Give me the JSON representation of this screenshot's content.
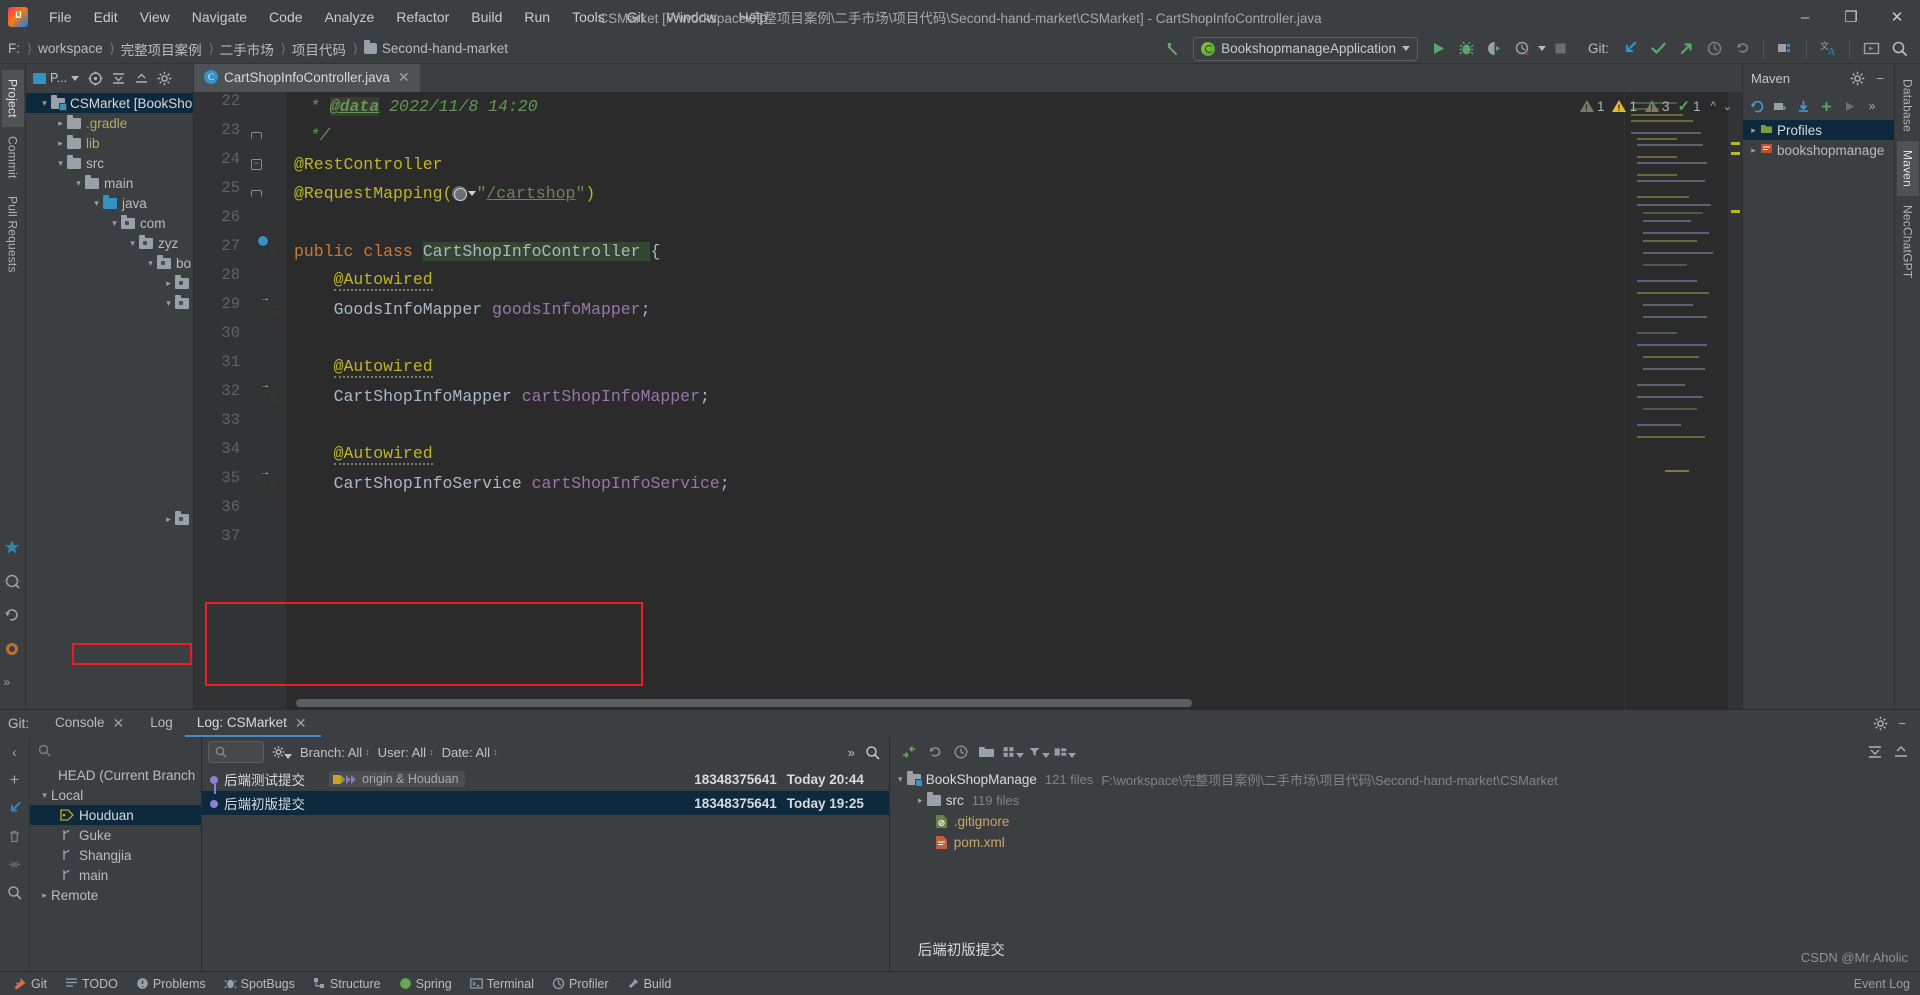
{
  "window": {
    "title": "CSMarket [F:\\workspace\\完整项目案例\\二手市场\\项目代码\\Second-hand-market\\CSMarket] - CartShopInfoController.java",
    "minimize": "–",
    "maximize": "❐",
    "close": "✕"
  },
  "menu": [
    "File",
    "Edit",
    "View",
    "Navigate",
    "Code",
    "Analyze",
    "Refactor",
    "Build",
    "Run",
    "Tools",
    "Git",
    "Window",
    "Help"
  ],
  "breadcrumbs": [
    {
      "label": "F:",
      "folder": false
    },
    {
      "label": "workspace",
      "folder": false
    },
    {
      "label": "完整项目案例",
      "folder": false
    },
    {
      "label": "二手市场",
      "folder": false
    },
    {
      "label": "项目代码",
      "folder": false
    },
    {
      "label": "Second-hand-market",
      "folder": true
    }
  ],
  "toolbar": {
    "run_config": "BookshopmanageApplication",
    "git_label": "Git:",
    "run_title": "Run",
    "debug_title": "Debug",
    "coverage_title": "Run with Coverage",
    "profile_title": "Profile",
    "stop_title": "Stop",
    "update_title": "Update Project",
    "commit_title": "Commit",
    "push_title": "Push",
    "history_title": "History",
    "rollback_title": "Rollback",
    "search_title": "Search Everywhere"
  },
  "left_rail": {
    "tabs": [
      "Project",
      "Commit",
      "Pull Requests"
    ],
    "active": "Project",
    "bottom": [
      "Favorites",
      "Structure",
      "Find",
      "Web"
    ]
  },
  "right_rail": {
    "tabs": [
      "Database",
      "Maven",
      "NecChatGPT"
    ]
  },
  "project_tool": {
    "title": "P...",
    "tree": [
      {
        "label": "CSMarket [BookShop",
        "depth": 0,
        "arrow": "v",
        "icon": "module",
        "selected": true,
        "style": "white"
      },
      {
        "label": ".gradle",
        "depth": 1,
        "arrow": ">",
        "icon": "folder",
        "style": "yellowish"
      },
      {
        "label": "lib",
        "depth": 1,
        "arrow": ">",
        "icon": "folder",
        "style": "yellowish"
      },
      {
        "label": "src",
        "depth": 1,
        "arrow": "v",
        "icon": "folder",
        "style": "plain"
      },
      {
        "label": "main",
        "depth": 2,
        "arrow": "v",
        "icon": "folder",
        "style": "plain"
      },
      {
        "label": "java",
        "depth": 3,
        "arrow": "v",
        "icon": "folder-blue",
        "style": "plain"
      },
      {
        "label": "com",
        "depth": 4,
        "arrow": "v",
        "icon": "package",
        "style": "plain"
      },
      {
        "label": "zyz",
        "depth": 5,
        "arrow": "v",
        "icon": "package",
        "style": "plain"
      },
      {
        "label": "bo",
        "depth": 6,
        "arrow": "v",
        "icon": "package",
        "style": "plain"
      },
      {
        "label": "",
        "depth": 7,
        "arrow": ">",
        "icon": "package",
        "style": "plain"
      },
      {
        "label": "",
        "depth": 7,
        "arrow": "v",
        "icon": "package",
        "style": "plain"
      },
      {
        "label": "",
        "depth": 7,
        "arrow": ">",
        "icon": "package",
        "style": "plain"
      }
    ]
  },
  "editor": {
    "tab": {
      "name": "CartShopInfoController.java",
      "icon_letter": "C",
      "close": "✕"
    },
    "inspections": [
      {
        "type": "warning-gray",
        "count": "1"
      },
      {
        "type": "warning-yellow",
        "count": "1"
      },
      {
        "type": "warning-gray",
        "count": "3"
      },
      {
        "type": "check-green",
        "count": "1"
      }
    ],
    "lines": [
      {
        "num": "22",
        "mark": "",
        "fold": "",
        "tokens": [
          {
            "t": " * ",
            "c": "cmt"
          },
          {
            "t": "@data",
            "c": "cmt-tag"
          },
          {
            "t": " 2022/11/8 14:20",
            "c": "cmt"
          }
        ]
      },
      {
        "num": "23",
        "mark": "",
        "fold": "half",
        "tokens": [
          {
            "t": " */",
            "c": "cmt"
          }
        ]
      },
      {
        "num": "24",
        "mark": "",
        "fold": "minus",
        "tokens": [
          {
            "t": "@RestController",
            "c": "anno"
          }
        ]
      },
      {
        "num": "25",
        "mark": "",
        "fold": "half",
        "tokens": [
          {
            "t": "@RequestMapping(",
            "c": "anno"
          },
          {
            "t": "GLOBE",
            "c": "globe"
          },
          {
            "t": "\"",
            "c": "str-plain"
          },
          {
            "t": "/cartshop",
            "c": "str"
          },
          {
            "t": "\"",
            "c": "str-plain"
          },
          {
            "t": ")",
            "c": "anno"
          }
        ]
      },
      {
        "num": "26",
        "mark": "",
        "fold": "",
        "tokens": []
      },
      {
        "num": "27",
        "mark": "bean-class",
        "fold": "",
        "tokens": [
          {
            "t": "public ",
            "c": "kw"
          },
          {
            "t": "class ",
            "c": "kw"
          },
          {
            "t": "CartShopInfoController ",
            "c": "cls-hl"
          },
          {
            "t": "{",
            "c": "plain"
          }
        ]
      },
      {
        "num": "28",
        "mark": "",
        "fold": "",
        "tokens": [
          {
            "t": "    ",
            "c": "plain"
          },
          {
            "t": "@Autowired",
            "c": "anno-sq"
          }
        ]
      },
      {
        "num": "29",
        "mark": "bean-arrow",
        "fold": "",
        "tokens": [
          {
            "t": "    ",
            "c": "plain"
          },
          {
            "t": "GoodsInfoMapper ",
            "c": "type"
          },
          {
            "t": "goodsInfoMapper",
            "c": "var"
          },
          {
            "t": ";",
            "c": "plain"
          }
        ]
      },
      {
        "num": "30",
        "mark": "",
        "fold": "",
        "tokens": []
      },
      {
        "num": "31",
        "mark": "",
        "fold": "",
        "tokens": [
          {
            "t": "    ",
            "c": "plain"
          },
          {
            "t": "@Autowired",
            "c": "anno-sq"
          }
        ]
      },
      {
        "num": "32",
        "mark": "bean-arrow",
        "fold": "",
        "tokens": [
          {
            "t": "    ",
            "c": "plain"
          },
          {
            "t": "CartShopInfoMapper ",
            "c": "type"
          },
          {
            "t": "cartShopInfoMapper",
            "c": "var"
          },
          {
            "t": ";",
            "c": "plain"
          }
        ]
      },
      {
        "num": "33",
        "mark": "",
        "fold": "",
        "tokens": []
      },
      {
        "num": "34",
        "mark": "",
        "fold": "",
        "tokens": [
          {
            "t": "    ",
            "c": "plain"
          },
          {
            "t": "@Autowired",
            "c": "anno-sq"
          }
        ]
      },
      {
        "num": "35",
        "mark": "bean-arrow",
        "fold": "",
        "tokens": [
          {
            "t": "    ",
            "c": "plain"
          },
          {
            "t": "CartShopInfoService ",
            "c": "type"
          },
          {
            "t": "cartShopInfoService",
            "c": "var"
          },
          {
            "t": ";",
            "c": "plain"
          }
        ]
      },
      {
        "num": "36",
        "mark": "",
        "fold": "",
        "tokens": []
      },
      {
        "num": "37",
        "mark": "",
        "fold": "",
        "tokens": []
      }
    ]
  },
  "maven": {
    "title": "Maven",
    "tree": [
      {
        "label": "Profiles",
        "arrow": ">",
        "selected": true
      },
      {
        "label": "bookshopmanage",
        "arrow": ">",
        "selected": false
      }
    ]
  },
  "git_panel": {
    "label": "Git:",
    "tabs": [
      {
        "label": "Console",
        "close": "✕",
        "active": false
      },
      {
        "label": "Log",
        "close": "",
        "active": false
      },
      {
        "label": "Log: CSMarket",
        "close": "✕",
        "active": true
      }
    ],
    "branch_tree": [
      {
        "label": "HEAD (Current Branch",
        "depth": 1,
        "arrow": "",
        "icon": "none",
        "selected": false
      },
      {
        "label": "Local",
        "depth": 0,
        "arrow": "v",
        "icon": "none",
        "selected": false
      },
      {
        "label": "Houduan",
        "depth": 2,
        "arrow": "",
        "icon": "tag",
        "selected": true
      },
      {
        "label": "Guke",
        "depth": 2,
        "arrow": "",
        "icon": "branch",
        "selected": false
      },
      {
        "label": "Shangjia",
        "depth": 2,
        "arrow": "",
        "icon": "branch",
        "selected": false
      },
      {
        "label": "main",
        "depth": 2,
        "arrow": "",
        "icon": "branch",
        "selected": false
      },
      {
        "label": "Remote",
        "depth": 0,
        "arrow": ">",
        "icon": "none",
        "selected": false
      }
    ],
    "filters": {
      "branch": "Branch: All",
      "user": "User: All",
      "date": "Date: All",
      "overflow": "»"
    },
    "commits": [
      {
        "subject": "后端测试提交",
        "labels": [
          "origin & Houduan"
        ],
        "author": "18348375641",
        "date": "Today 20:44",
        "selected": false
      },
      {
        "subject": "后端初版提交",
        "labels": [],
        "author": "18348375641",
        "date": "Today 19:25",
        "selected": true
      }
    ],
    "detail_tree": [
      {
        "label": "BookShopManage",
        "meta": "121 files",
        "path": "F:\\workspace\\完整项目案例\\二手市场\\项目代码\\Second-hand-market\\CSMarket",
        "depth": 0,
        "arrow": "v",
        "icon": "module"
      },
      {
        "label": "src",
        "meta": "119 files",
        "path": "",
        "depth": 1,
        "arrow": ">",
        "icon": "folder"
      },
      {
        "label": ".gitignore",
        "meta": "",
        "path": "",
        "depth": 2,
        "arrow": "",
        "icon": "gitignore"
      },
      {
        "label": "pom.xml",
        "meta": "",
        "path": "",
        "depth": 2,
        "arrow": "",
        "icon": "xml"
      }
    ],
    "detail_message": "后端初版提交"
  },
  "statusbar": {
    "items": [
      "Git",
      "TODO",
      "Problems",
      "SpotBugs",
      "Structure",
      "Spring",
      "Terminal",
      "Profiler",
      "Build"
    ],
    "event_log": "Event Log"
  },
  "watermark": "CSDN @Mr.Aholic",
  "colors": {
    "accent": "#4a88c7",
    "highlight_box": "#ee1d25",
    "selection": "#0d293e",
    "annotation": "#bbb529",
    "comment": "#629755",
    "keyword": "#cc7832",
    "string": "#6a8759",
    "variable": "#9876aa",
    "graph_node": "#8f7fd4"
  }
}
